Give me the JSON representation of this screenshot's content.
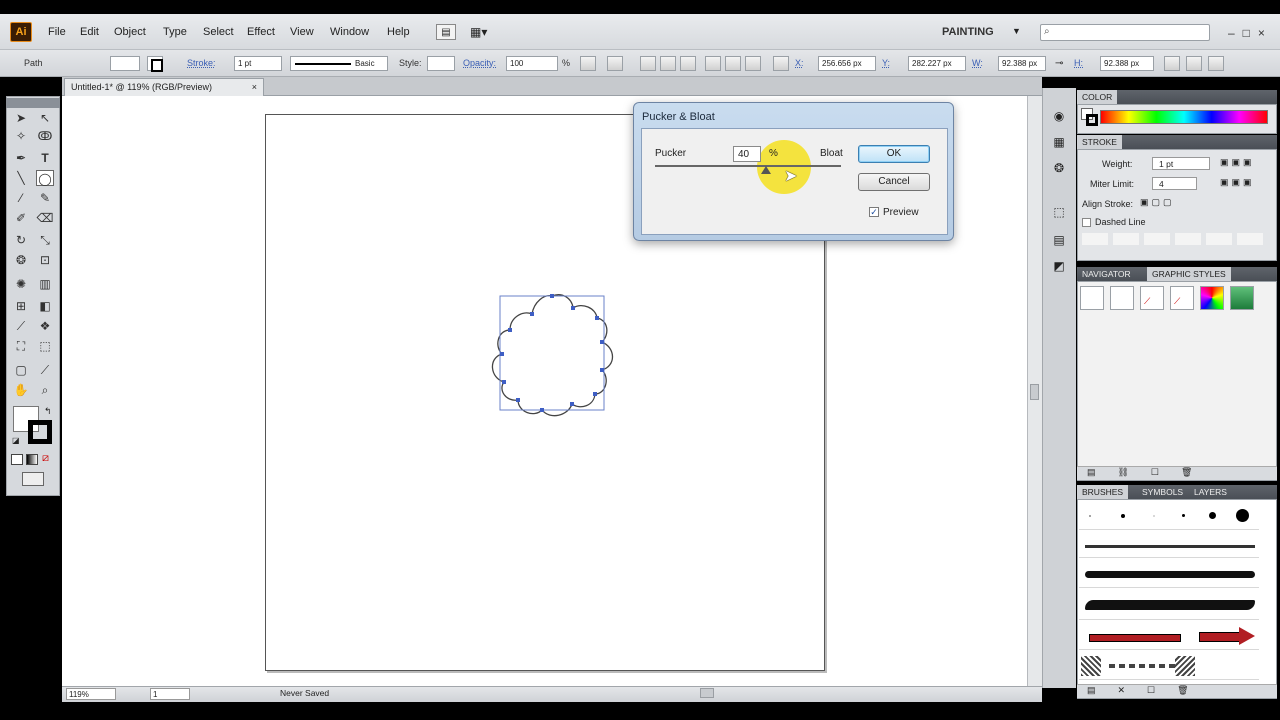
{
  "app": {
    "logo": "Ai",
    "menu": [
      "File",
      "Edit",
      "Object",
      "Type",
      "Select",
      "Effect",
      "View",
      "Window",
      "Help"
    ],
    "workspace": "PAINTING",
    "search_placeholder": ""
  },
  "control_bar": {
    "selection_type": "Path",
    "stroke_label": "Stroke:",
    "stroke_weight": "1 pt",
    "brush_label": "Basic",
    "style_label": "Style:",
    "opacity_label": "Opacity:",
    "opacity_value": "100",
    "opacity_unit": "%",
    "x_label": "X:",
    "x_value": "256.656 px",
    "y_label": "Y:",
    "y_value": "282.227 px",
    "w_label": "W:",
    "w_value": "92.388 px",
    "h_label": "H:",
    "h_value": "92.388 px"
  },
  "document": {
    "tab_title": "Untitled-1* @ 119% (RGB/Preview)",
    "close_glyph": "×"
  },
  "status_bar": {
    "zoom": "119%",
    "artboard": "1",
    "status_text": "Never Saved"
  },
  "panels": {
    "color": {
      "title": "COLOR"
    },
    "stroke": {
      "title": "STROKE",
      "weight_label": "Weight:",
      "weight_value": "1 pt",
      "miter_label": "Miter Limit:",
      "miter_value": "4",
      "align_label": "Align Stroke:",
      "dashed_label": "Dashed Line"
    },
    "navigator_tab": "NAVIGATOR",
    "graphic_styles_tab": "GRAPHIC STYLES",
    "brushes_tab": "BRUSHES",
    "symbols_tab": "SYMBOLS",
    "layers_tab": "LAYERS"
  },
  "dialog": {
    "title": "Pucker & Bloat",
    "pucker_label": "Pucker",
    "value": "40",
    "unit": "%",
    "bloat_label": "Bloat",
    "ok_label": "OK",
    "cancel_label": "Cancel",
    "preview_label": "Preview",
    "preview_checked": true
  },
  "colors": {
    "accent_link": "#3a5fb5",
    "highlight": "#f5e11e",
    "ai_logo_bg": "#3a1d04",
    "ai_logo_fg": "#f7a21b"
  }
}
